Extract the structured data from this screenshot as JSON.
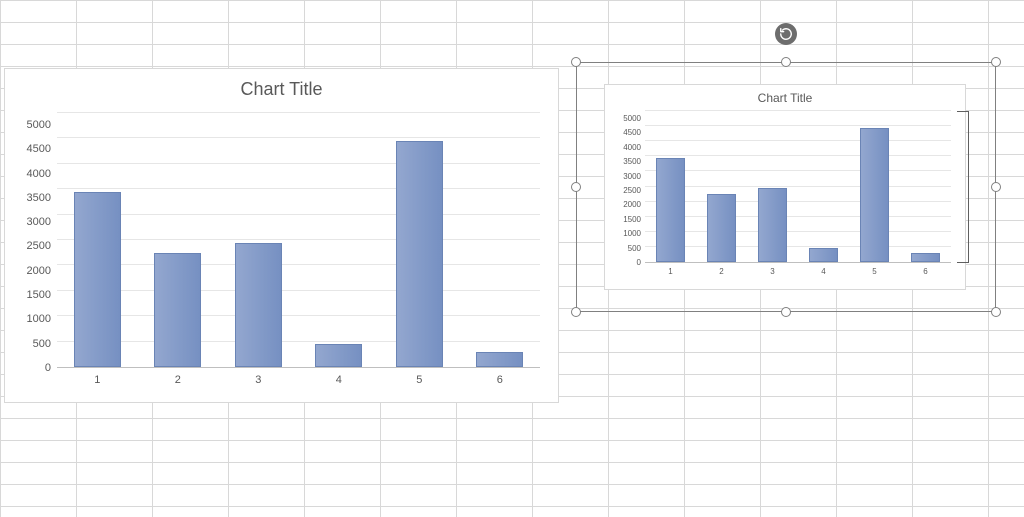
{
  "chart_data": [
    {
      "id": "main",
      "type": "bar",
      "title": "Chart Title",
      "categories": [
        "1",
        "2",
        "3",
        "4",
        "5",
        "6"
      ],
      "values": [
        3450,
        2250,
        2450,
        450,
        4450,
        300
      ],
      "xlabel": "",
      "ylabel": "",
      "ylim": [
        0,
        5000
      ],
      "ytick_step": 500,
      "selected": false
    },
    {
      "id": "small",
      "type": "bar",
      "title": "Chart Title",
      "categories": [
        "1",
        "2",
        "3",
        "4",
        "5",
        "6"
      ],
      "values": [
        3450,
        2250,
        2450,
        450,
        4450,
        300
      ],
      "xlabel": "",
      "ylabel": "",
      "ylim": [
        0,
        5000
      ],
      "ytick_step": 500,
      "selected": true
    }
  ],
  "titles": {
    "main": "Chart Title",
    "small": "Chart Title"
  }
}
